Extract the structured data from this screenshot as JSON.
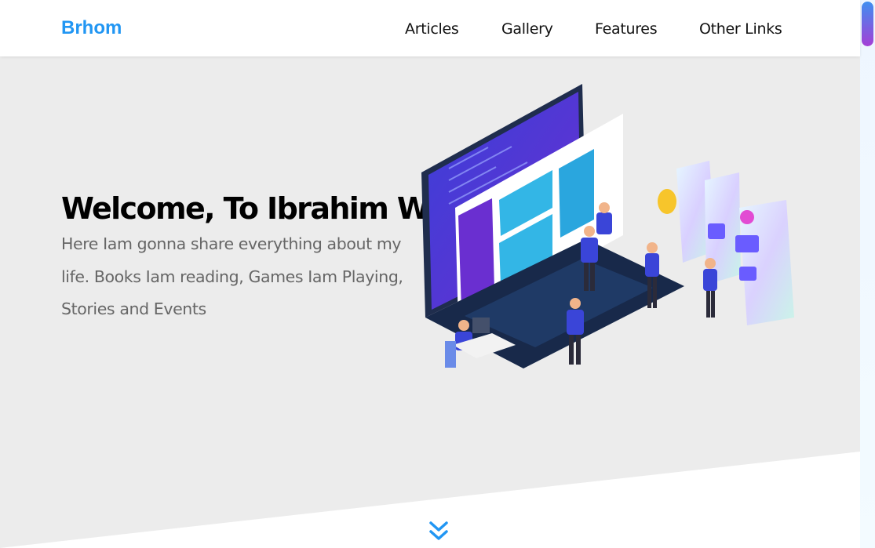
{
  "header": {
    "logo": "Brhom",
    "nav": [
      {
        "label": "Articles"
      },
      {
        "label": "Gallery"
      },
      {
        "label": "Features"
      },
      {
        "label": "Other Links"
      }
    ]
  },
  "hero": {
    "title": "Welcome, To Ibrahim World",
    "description": "Here Iam gonna share everything about my life. Books Iam reading, Games Iam Playing, Stories and Events",
    "illustration_icon": "ux-developers-illustration"
  },
  "colors": {
    "brand": "#2196f3",
    "hero_background": "#ececec",
    "scrollbar_start": "#3f8ff0",
    "scrollbar_end": "#a43fd6"
  },
  "scroll_icon": "chevron-double-down-icon"
}
